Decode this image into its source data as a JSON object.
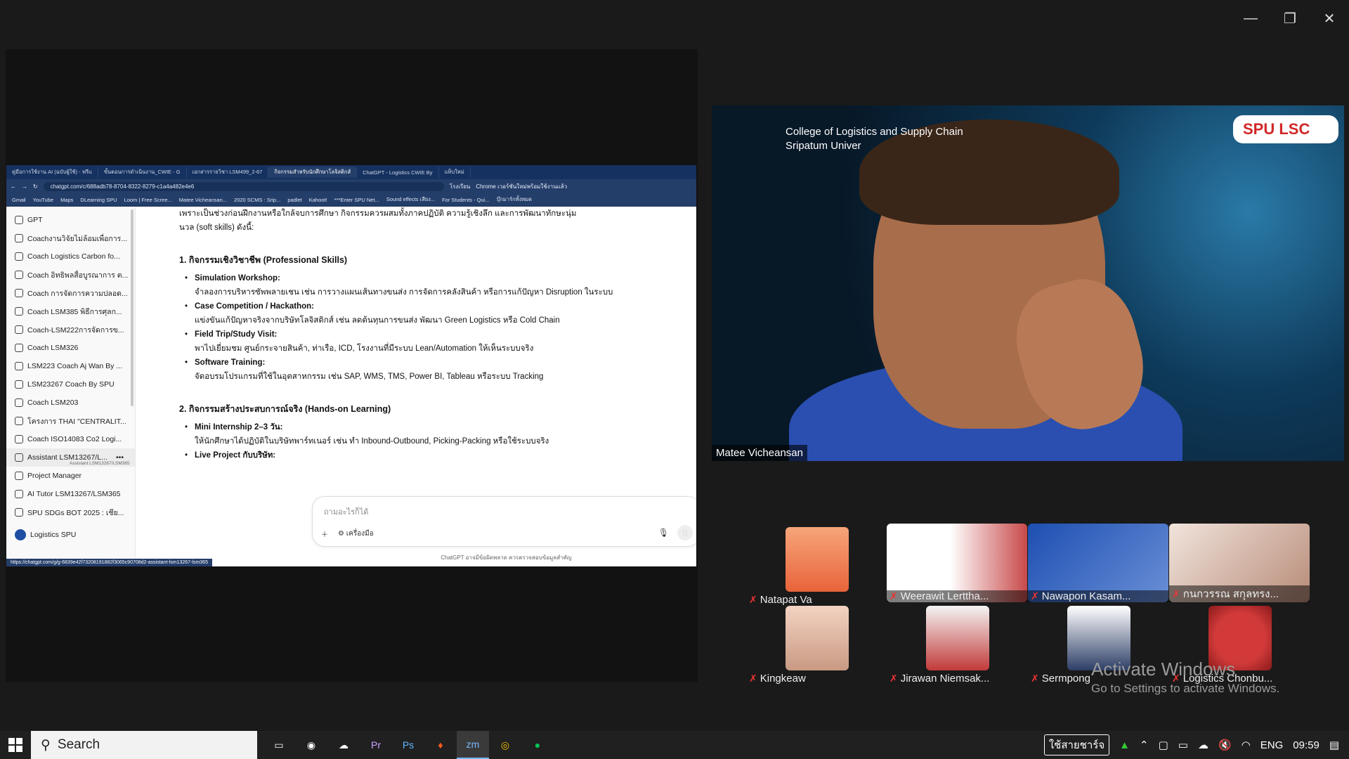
{
  "window": {
    "minimize": "—",
    "restore": "❐",
    "close": "✕"
  },
  "browser": {
    "tabs": [
      "คู่มือการใช้งาน AI (ฉบับผู้ใช้) - ฟรีแ",
      "ขั้นตอนการดำเนินงาน_CWIE - G",
      "เอกสารรายวิชา LSM499_2-67",
      "กิจกรรมสำหรับนักศึกษาโลจิสติกส์",
      "ChatGPT - Logistics CWIE By",
      "แท็บใหม่"
    ],
    "url": "chatgpt.com/c/688adb78-8704-8322-8279-c1a4a482e4e6",
    "right_buttons": [
      "โรงเรียน",
      "Chrome เวอร์ชันใหม่พร้อมใช้งานแล้ว"
    ],
    "bookmarks": [
      "Gmail",
      "YouTube",
      "Maps",
      "DLearning SPU",
      "Loom | Free Scree...",
      "Matee Vicheansan...",
      "2020 SCMS : Srip...",
      "padlet",
      "Kahoot!",
      "***Enter SPU Net...",
      "Sound effects เสียง...",
      "For Students - Qui...",
      "บุ๊กมาร์กทั้งหมด"
    ],
    "status_url": "https://chatgpt.com/g/g-6839e42f73208191882f3065c90708d2-assistant-lsm13267-lsm365"
  },
  "sidebar": {
    "items": [
      "GPT",
      "Coachงานวิจัยไม่ล้อมเพื่อการ...",
      "Coach Logistics Carbon fo...",
      "Coach อิทธิพลสื่อบูรณาการ ต...",
      "Coach การจัดการความปลอด...",
      "Coach LSM385 พิธีการศุลก...",
      "Coach-LSM222การจัดการข...",
      "Coach LSM326",
      "LSM223 Coach Aj Wan By ...",
      "LSM23267 Coach By SPU",
      "Coach LSM203",
      "โครงการ THAI \"CENTRALIT...",
      "Coach ISO14083 Co2 Logi...",
      "Assistant LSM13267/L...",
      "Project Manager",
      "AI Tutor LSM13267/LSM365",
      "SPU SDGs BOT 2025 : เชีย..."
    ],
    "tooltip": "Assistant LSM13267/LSM365",
    "user": "Logistics SPU"
  },
  "chat": {
    "intro1": "เพราะเป็นช่วงก่อนฝึกงานหรือใกล้จบการศึกษา กิจกรรมควรผสมทั้งภาคปฏิบัติ ความรู้เชิงลึก และการพัฒนาทักษะนุ่ม",
    "intro2": "นวล (soft skills) ดังนี้:",
    "section1": "1. กิจกรรมเชิงวิชาชีพ (Professional Skills)",
    "s1": [
      {
        "title": "Simulation Workshop:",
        "desc": "จำลองการบริหารซัพพลายเชน เช่น การวางแผนเส้นทางขนส่ง การจัดการคลังสินค้า หรือการแก้ปัญหา Disruption ในระบบ"
      },
      {
        "title": "Case Competition / Hackathon:",
        "desc": "แข่งขันแก้ปัญหาจริงจากบริษัทโลจิสติกส์ เช่น ลดต้นทุนการขนส่ง พัฒนา Green Logistics หรือ Cold Chain"
      },
      {
        "title": "Field Trip/Study Visit:",
        "desc": "พาไปเยี่ยมชม ศูนย์กระจายสินค้า, ท่าเรือ, ICD, โรงงานที่มีระบบ Lean/Automation ให้เห็นระบบจริง"
      },
      {
        "title": "Software Training:",
        "desc": "จัดอบรมโปรแกรมที่ใช้ในอุตสาหกรรม เช่น SAP, WMS, TMS, Power BI, Tableau หรือระบบ Tracking"
      }
    ],
    "section2": "2. กิจกรรมสร้างประสบการณ์จริง (Hands-on Learning)",
    "s2": [
      {
        "title": "Mini Internship 2–3 วัน:",
        "desc": "ให้นักศึกษาได้ปฏิบัติในบริษัทพาร์ทเนอร์ เช่น ทำ Inbound-Outbound, Picking-Packing หรือใช้ระบบจริง"
      },
      {
        "title": "Live Project กับบริษัท:",
        "desc": ""
      }
    ],
    "placeholder": "ถามอะไรก็ได้",
    "tools": "เครื่องมือ",
    "disclaimer": "ChatGPT อาจมีข้อผิดพลาด ควรตรวจสอบข้อมูลสำคัญ"
  },
  "speaker": {
    "name": "Matee Vicheansan",
    "college_line1": "College of Logistics and Supply Chain",
    "college_line2": "Sripatum Univer",
    "logo": "SPU LSC"
  },
  "participants": [
    {
      "name": "Natapat Va"
    },
    {
      "name": "Weerawit Lerttha..."
    },
    {
      "name": "Nawapon Kasam..."
    },
    {
      "name": "กนกวรรณ สกุลทรง..."
    },
    {
      "name": "Kingkeaw"
    },
    {
      "name": "Jirawan Niemsak..."
    },
    {
      "name": "Sermpong"
    },
    {
      "name": "Logistics Chonbu..."
    }
  ],
  "watermark": {
    "line1": "Activate Windows",
    "line2": "Go to Settings to activate Windows."
  },
  "taskbar": {
    "search": "Search",
    "lang_badge": "ใช้สายชาร์จ",
    "lang": "ENG",
    "time": "09:59"
  }
}
